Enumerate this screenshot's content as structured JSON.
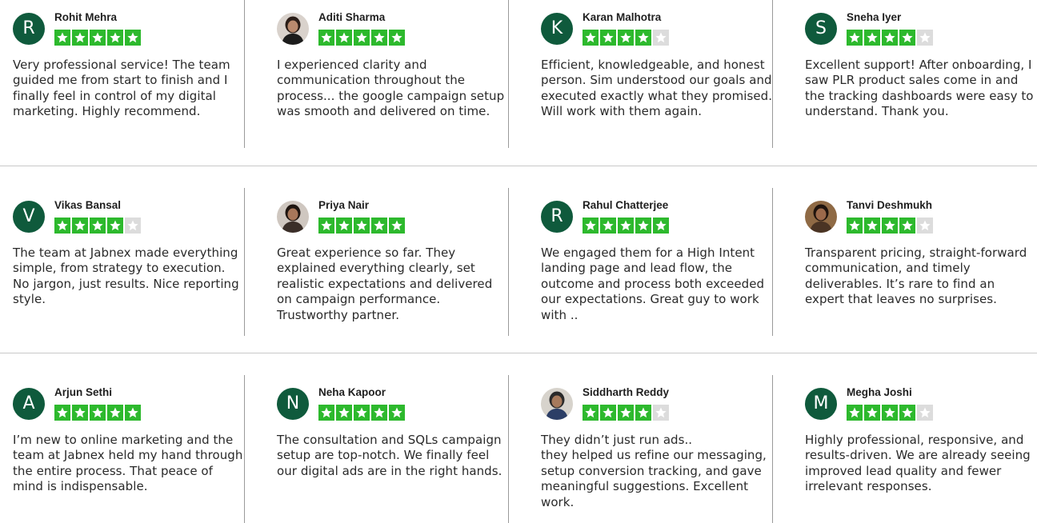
{
  "reviews": [
    {
      "name": "Rohit Mehra",
      "avatar": {
        "type": "letter",
        "letter": "R"
      },
      "rating": 5,
      "text": "Very professional service! The team guided me from start to finish and I finally feel in control of my digital marketing. Highly recommend."
    },
    {
      "name": "Aditi Sharma",
      "avatar": {
        "type": "photo",
        "icon": "person-photo-icon"
      },
      "rating": 5,
      "text": "I experienced clarity and communication throughout the process... the google campaign setup was smooth and delivered on time."
    },
    {
      "name": "Karan Malhotra",
      "avatar": {
        "type": "letter",
        "letter": "K"
      },
      "rating": 4,
      "text": "Efficient, knowledgeable, and honest person. Sim understood our goals and executed exactly what they promised. Will work with them again."
    },
    {
      "name": "Sneha Iyer",
      "avatar": {
        "type": "letter",
        "letter": "S"
      },
      "rating": 4,
      "text": "Excellent support! After onboarding, I saw PLR product sales come in and the tracking dashboards were easy to understand. Thank you."
    },
    {
      "name": "Vikas Bansal",
      "avatar": {
        "type": "letter",
        "letter": "V"
      },
      "rating": 4,
      "text": "The team at Jabnex made everything simple, from strategy to execution. No jargon, just results. Nice reporting style."
    },
    {
      "name": "Priya Nair",
      "avatar": {
        "type": "photo",
        "icon": "person-photo-icon"
      },
      "rating": 5,
      "text": "Great experience so far. They explained everything clearly, set realistic expectations and delivered on campaign performance. Trustworthy partner."
    },
    {
      "name": "Rahul Chatterjee",
      "avatar": {
        "type": "letter",
        "letter": "R"
      },
      "rating": 5,
      "text": "We engaged them for a High Intent landing page and lead flow, the outcome and process both exceeded our expectations. Great guy to work with .."
    },
    {
      "name": "Tanvi Deshmukh",
      "avatar": {
        "type": "photo",
        "icon": "person-photo-icon"
      },
      "rating": 4,
      "text": "Transparent pricing, straight-forward communication, and timely deliverables. It’s rare to find an expert that leaves no surprises."
    },
    {
      "name": "Arjun Sethi",
      "avatar": {
        "type": "letter",
        "letter": "A"
      },
      "rating": 5,
      "text": "I’m new to online marketing and the team at Jabnex held my hand through the entire process. That peace of mind is indispensable."
    },
    {
      "name": "Neha Kapoor",
      "avatar": {
        "type": "letter",
        "letter": "N"
      },
      "rating": 5,
      "text": "The consultation and SQLs campaign setup are top-notch. We finally feel our digital ads are in the right hands."
    },
    {
      "name": "Siddharth Reddy",
      "avatar": {
        "type": "photo",
        "icon": "person-photo-icon"
      },
      "rating": 4,
      "text": "They didn’t just run ads..\nthey helped us refine our messaging, setup conversion tracking, and gave meaningful suggestions. Excellent work."
    },
    {
      "name": "Megha Joshi",
      "avatar": {
        "type": "letter",
        "letter": "M"
      },
      "rating": 4,
      "text": "Highly professional, responsive, and results-driven. We are already seeing improved lead quality and fewer irrelevant responses."
    }
  ],
  "colors": {
    "star_filled": "#2db92d",
    "star_empty": "#dcdcdc",
    "avatar_bg": "#0f5a3c",
    "divider": "#c9c9c9"
  }
}
